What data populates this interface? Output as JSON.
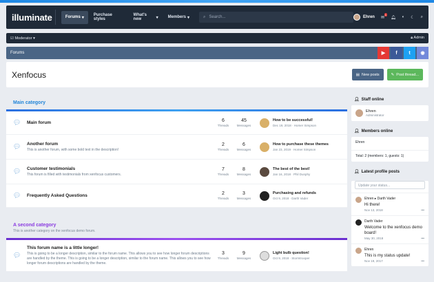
{
  "header": {
    "logo": "illuminate",
    "nav": [
      "Forums",
      "Purchase styles",
      "What's new",
      "Members"
    ],
    "search_placeholder": "Search...",
    "username": "Ehren",
    "badge": "1"
  },
  "modbar": {
    "left": "Moderator",
    "right": "Admin"
  },
  "breadcrumb": "Forums",
  "title": "Xenfocus",
  "buttons": {
    "new_posts": "New posts",
    "post_thread": "Post thread..."
  },
  "categories": [
    {
      "title": "Main category",
      "desc": "",
      "forums": [
        {
          "title": "Main forum",
          "desc": "",
          "threads": "6",
          "messages": "45",
          "latest_title": "How to be successful!",
          "latest_meta": "Dec 19, 2018 · Homer Simpson"
        },
        {
          "title": "Another forum",
          "desc": "This is another forum, with some bold text in the description!",
          "threads": "2",
          "messages": "6",
          "latest_title": "How to purchase these themes",
          "latest_meta": "Jan 23, 2019 · Homer Simpson"
        },
        {
          "title": "Customer testimonials",
          "desc": "This forum is filled with testimonials from xenfocus customers.",
          "threads": "7",
          "messages": "8",
          "latest_title": "The best of the best!",
          "latest_meta": "Jan 16, 2018 · Phil Dunphy"
        },
        {
          "title": "Frequently Asked Questions",
          "desc": "",
          "threads": "2",
          "messages": "3",
          "latest_title": "Purchasing and refunds",
          "latest_meta": "Oct 9, 2018 · Darth Vader"
        }
      ]
    },
    {
      "title": "A second category",
      "desc": "This is another category on the xenfocus demo forum.",
      "forums": [
        {
          "title": "This forum name is a little longer!",
          "desc": "This is going to be a longer description, similar to the forum name. This allows you to see how longer forum descriptions are handled by the theme. This is going to be a longer description, similar to the forum name. This allows you to see how longer forum descriptions are handled by the theme.",
          "threads": "3",
          "messages": "9",
          "latest_title": "Light bulb question!",
          "latest_meta": "Oct 9, 2018 · Stormtrooper"
        }
      ]
    }
  ],
  "stat_labels": {
    "threads": "Threads",
    "messages": "Messages"
  },
  "sidebar": {
    "staff_title": "Staff online",
    "staff": {
      "name": "Ehren",
      "role": "Administrator"
    },
    "members_title": "Members online",
    "members_list": "Ehren",
    "members_total": "Total: 2 (members: 1, guests: 1)",
    "profile_title": "Latest profile posts",
    "status_placeholder": "Update your status...",
    "posts": [
      {
        "name": "Ehren ▸ Darth Vader",
        "msg": "Hi there!",
        "date": "Nov 13, 2018"
      },
      {
        "name": "Darth Vader",
        "msg": "Welcome to the xenfocus demo board!",
        "date": "May 30, 2018"
      },
      {
        "name": "Ehren",
        "msg": "This is my status update!",
        "date": "Nov 19, 2017"
      }
    ]
  },
  "colors": {
    "accent": "#2285d8",
    "header": "#1f2a38",
    "crumb": "#4a6585",
    "second_category": "#8a3ae0"
  }
}
